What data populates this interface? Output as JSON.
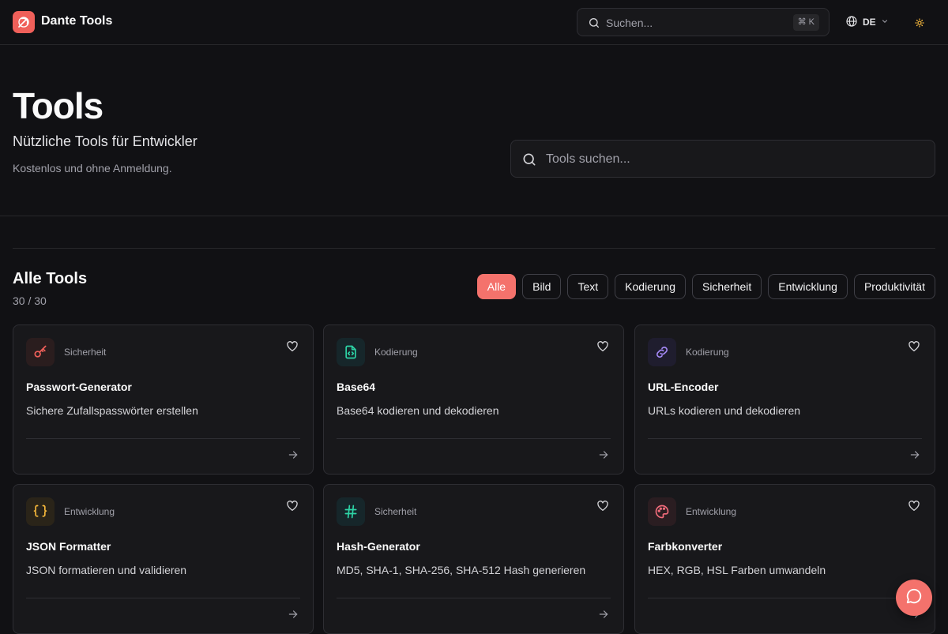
{
  "header": {
    "brand": "Dante Tools",
    "search_placeholder": "Suchen...",
    "shortcut": "⌘ K",
    "language": "DE"
  },
  "hero": {
    "title": "Tools",
    "subtitle": "Nützliche Tools für Entwickler",
    "note": "Kostenlos und ohne Anmeldung.",
    "search_placeholder": "Tools suchen..."
  },
  "section": {
    "title": "Alle Tools",
    "count": "30 / 30"
  },
  "filters": [
    "Alle",
    "Bild",
    "Text",
    "Kodierung",
    "Sicherheit",
    "Entwicklung",
    "Produktivität"
  ],
  "active_filter": "Alle",
  "tools": [
    {
      "category": "Sicherheit",
      "name": "Passwort-Generator",
      "description": "Sichere Zufallspasswörter erstellen",
      "icon": "key-icon",
      "color": "#f0605a",
      "bg": "#2a1d1e"
    },
    {
      "category": "Kodierung",
      "name": "Base64",
      "description": "Base64 kodieren und dekodieren",
      "icon": "file-code-icon",
      "color": "#2dd4a6",
      "bg": "#16262a"
    },
    {
      "category": "Kodierung",
      "name": "URL-Encoder",
      "description": "URLs kodieren und dekodieren",
      "icon": "link-icon",
      "color": "#a78bfa",
      "bg": "#1f1d2e"
    },
    {
      "category": "Entwicklung",
      "name": "JSON Formatter",
      "description": "JSON formatieren und validieren",
      "icon": "braces-icon",
      "color": "#f5b73b",
      "bg": "#2a2419"
    },
    {
      "category": "Sicherheit",
      "name": "Hash-Generator",
      "description": "MD5, SHA-1, SHA-256, SHA-512 Hash generieren",
      "icon": "hash-icon",
      "color": "#2dd4a6",
      "bg": "#16262a"
    },
    {
      "category": "Entwicklung",
      "name": "Farbkonverter",
      "description": "HEX, RGB, HSL Farben umwandeln",
      "icon": "palette-icon",
      "color": "#f06b7a",
      "bg": "#2a1d21"
    }
  ],
  "colors": {
    "accent": "#f4726c",
    "background": "#111114",
    "card": "#18181b"
  }
}
